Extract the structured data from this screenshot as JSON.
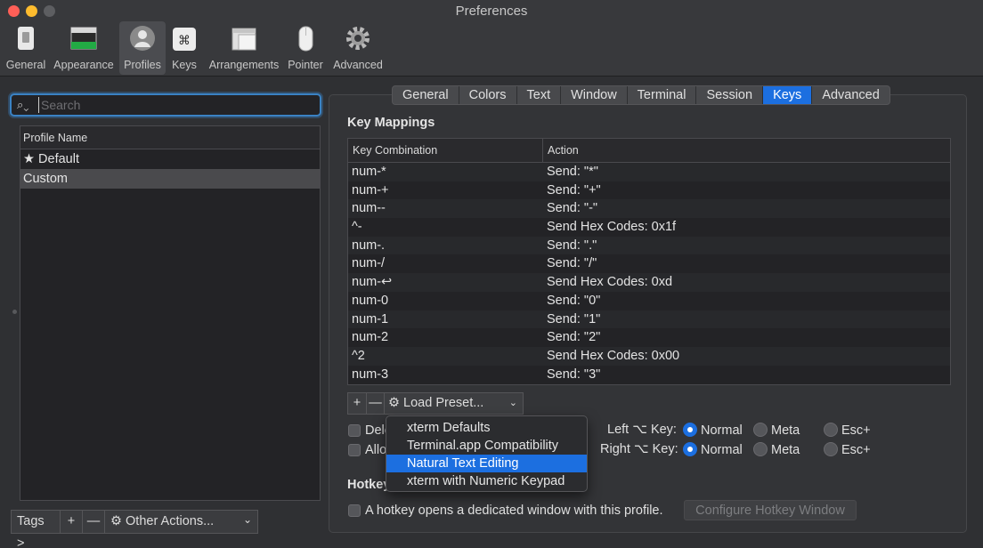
{
  "window": {
    "title": "Preferences"
  },
  "toolbar": {
    "items": [
      {
        "label": "General",
        "icon": "general-switch-icon"
      },
      {
        "label": "Appearance",
        "icon": "appearance-window-icon"
      },
      {
        "label": "Profiles",
        "icon": "profiles-person-icon",
        "active": true
      },
      {
        "label": "Keys",
        "icon": "keys-command-icon"
      },
      {
        "label": "Arrangements",
        "icon": "arrangements-windows-icon"
      },
      {
        "label": "Pointer",
        "icon": "pointer-mouse-icon"
      },
      {
        "label": "Advanced",
        "icon": "advanced-gear-icon"
      }
    ]
  },
  "search": {
    "placeholder": "Search",
    "value": ""
  },
  "profiles": {
    "header": "Profile Name",
    "items": [
      {
        "label": "Default",
        "default_marker": "★"
      },
      {
        "label": "Custom",
        "selected": true
      }
    ]
  },
  "left_bottom": {
    "tags": "Tags >",
    "add": "+",
    "remove": "—",
    "other_actions": "Other Actions...",
    "gear": "⚙",
    "chevron": "⌄"
  },
  "tabs": [
    {
      "label": "General"
    },
    {
      "label": "Colors"
    },
    {
      "label": "Text"
    },
    {
      "label": "Window"
    },
    {
      "label": "Terminal"
    },
    {
      "label": "Session"
    },
    {
      "label": "Keys",
      "active": true
    },
    {
      "label": "Advanced"
    }
  ],
  "key_mappings": {
    "title": "Key Mappings",
    "columns": [
      "Key Combination",
      "Action"
    ],
    "rows": [
      {
        "key": "num-*",
        "action": "Send: \"*\""
      },
      {
        "key": "num-+",
        "action": "Send: \"+\""
      },
      {
        "key": "num--",
        "action": "Send: \"-\""
      },
      {
        "key": "^-",
        "action": "Send Hex Codes: 0x1f"
      },
      {
        "key": "num-.",
        "action": "Send: \".\""
      },
      {
        "key": "num-/",
        "action": "Send: \"/\""
      },
      {
        "key": "num-↩",
        "action": "Send Hex Codes: 0xd"
      },
      {
        "key": "num-0",
        "action": "Send: \"0\""
      },
      {
        "key": "num-1",
        "action": "Send: \"1\""
      },
      {
        "key": "num-2",
        "action": "Send: \"2\""
      },
      {
        "key": "^2",
        "action": "Send Hex Codes: 0x00"
      },
      {
        "key": "num-3",
        "action": "Send: \"3\""
      }
    ],
    "add": "+",
    "remove": "—",
    "load_preset": "Load Preset...",
    "preset_chevron": "⌄",
    "gear": "⚙"
  },
  "preset_menu": {
    "items": [
      "xterm Defaults",
      "Terminal.app Compatibility",
      "Natural Text Editing",
      "xterm with Numeric Keypad"
    ],
    "highlighted_index": 2
  },
  "options": {
    "checkbox1_partial": "Dele",
    "checkbox2_partial": "Allo",
    "left_option_label": "Left ⌥ Key:",
    "right_option_label": "Right ⌥ Key:",
    "normal": "Normal",
    "meta": "Meta",
    "esc": "Esc+"
  },
  "hotkey": {
    "title_partial": "Hotkey",
    "checkbox_label": "A hotkey opens a dedicated window with this profile.",
    "configure_button": "Configure Hotkey Window"
  },
  "colors": {
    "accent": "#1c6fe0",
    "focus_ring": "#3a82c4"
  }
}
